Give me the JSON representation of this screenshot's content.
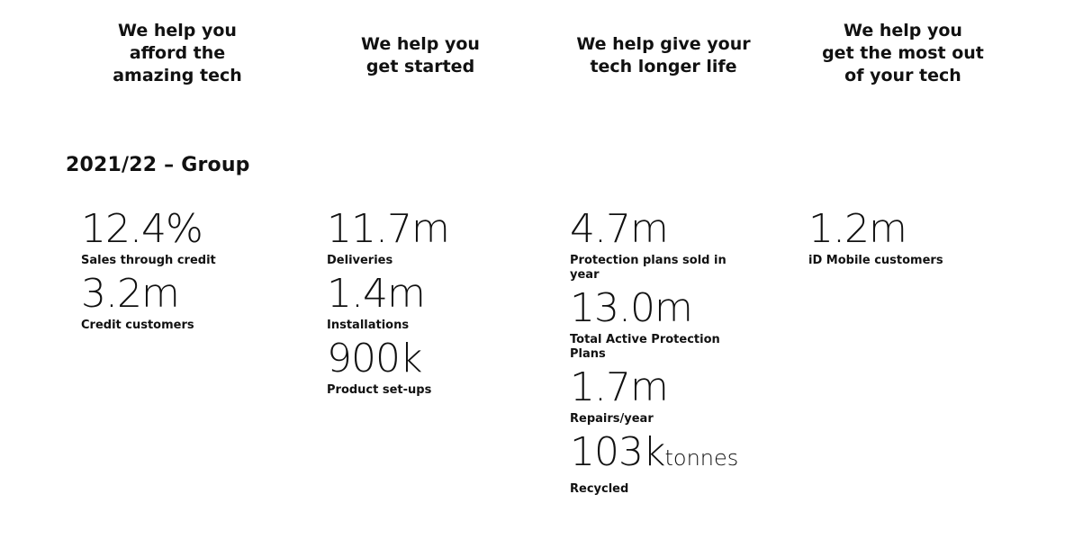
{
  "headings": [
    "We help you\nafford the\namazing tech",
    "We help you\nget started",
    "We help give your\ntech longer life",
    "We help you\nget the most out\nof your tech"
  ],
  "period": "2021/22 – Group",
  "columns": [
    {
      "stats": [
        {
          "value": "12.4%",
          "label": "Sales through credit"
        },
        {
          "value": "3.2m",
          "label": "Credit customers"
        }
      ]
    },
    {
      "stats": [
        {
          "value": "11.7m",
          "label": "Deliveries"
        },
        {
          "value": "1.4m",
          "label": "Installations"
        },
        {
          "value": "900k",
          "label": "Product set-ups"
        }
      ]
    },
    {
      "stats": [
        {
          "value": "4.7m",
          "label": "Protection plans sold in year"
        },
        {
          "value": "13.0m",
          "label": "Total Active Protection Plans"
        },
        {
          "value": "1.7m",
          "label": "Repairs/year"
        },
        {
          "value": "103k",
          "unit": "tonnes",
          "label": "Recycled"
        }
      ]
    },
    {
      "stats": [
        {
          "value": "1.2m",
          "label": "iD Mobile customers"
        }
      ]
    }
  ]
}
